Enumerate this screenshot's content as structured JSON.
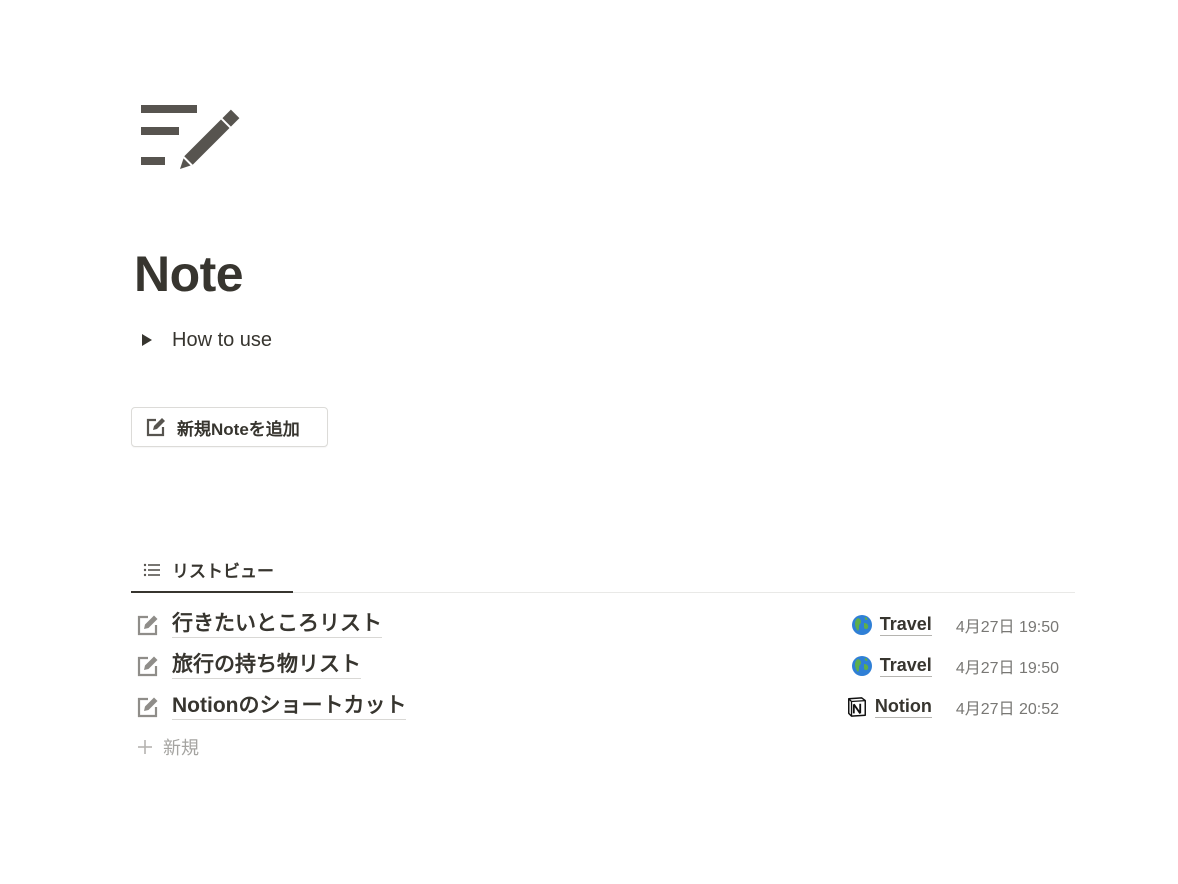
{
  "page": {
    "icon": "note-pencil-icon",
    "title": "Note"
  },
  "toggle": {
    "label": "How to use",
    "state": "collapsed"
  },
  "add_button": {
    "icon": "edit-icon",
    "label": "新規Noteを追加"
  },
  "view_tabs": [
    {
      "icon": "list-icon",
      "label": "リストビュー",
      "active": true
    }
  ],
  "list": {
    "items": [
      {
        "icon": "edit-icon",
        "title": "行きたいところリスト",
        "tag_emoji": "globe-icon",
        "tag": "Travel",
        "date": "4月27日 19:50"
      },
      {
        "icon": "edit-icon",
        "title": "旅行の持ち物リスト",
        "tag_emoji": "globe-icon",
        "tag": "Travel",
        "date": "4月27日 19:50"
      },
      {
        "icon": "edit-icon",
        "title": "Notionのショートカット",
        "tag_emoji": "notion-logo-icon",
        "tag": "Notion",
        "date": "4月27日 20:52"
      }
    ],
    "new_label": "新規"
  },
  "colors": {
    "text": "#37352f",
    "muted": "#787774",
    "placeholder": "#a5a4a1",
    "icon_gray": "#57544f",
    "divider": "#e9e9e7"
  }
}
